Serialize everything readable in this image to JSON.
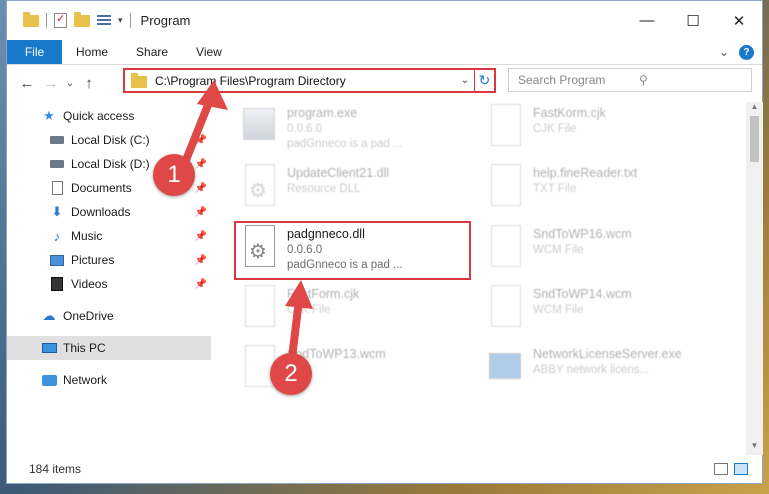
{
  "window": {
    "title": "Program",
    "controls": {
      "minimize": "—",
      "maximize": "☐",
      "close": "✕"
    }
  },
  "ribbon": {
    "tabs": [
      "File",
      "Home",
      "Share",
      "View"
    ],
    "expand": "⌄",
    "help": "?"
  },
  "nav": {
    "back": "←",
    "forward": "→",
    "recent": "⌄",
    "up": "↑",
    "address": "C:\\Program Files\\Program Directory",
    "address_dropdown": "⌄",
    "refresh": "↻",
    "search_placeholder": "Search Program",
    "search_icon": "⚲"
  },
  "sidebar": {
    "items": [
      {
        "label": "Quick access",
        "icon": "star-icon"
      },
      {
        "label": "Local Disk (C:)",
        "icon": "drive-icon",
        "pinned": true
      },
      {
        "label": "Local Disk (D:)",
        "icon": "drive-icon",
        "pinned": true
      },
      {
        "label": "Documents",
        "icon": "document-icon",
        "pinned": true
      },
      {
        "label": "Downloads",
        "icon": "download-icon",
        "pinned": true
      },
      {
        "label": "Music",
        "icon": "music-icon",
        "pinned": true
      },
      {
        "label": "Pictures",
        "icon": "picture-icon",
        "pinned": true
      },
      {
        "label": "Videos",
        "icon": "video-icon",
        "pinned": true
      },
      {
        "label": "OneDrive",
        "icon": "cloud-icon"
      },
      {
        "label": "This PC",
        "icon": "computer-icon",
        "selected": true
      },
      {
        "label": "Network",
        "icon": "network-icon"
      }
    ],
    "pin_glyph": "📌"
  },
  "files": [
    {
      "name": "program.exe",
      "line2": "0.0.6.0",
      "line3": "padGnneco is a pad ...",
      "icon": "exe-icon"
    },
    {
      "name": "UpdateClient21.dll",
      "line2": "Resource DLL",
      "line3": "",
      "icon": "dll-icon"
    },
    {
      "name": "padgnneco.dll",
      "line2": "0.0.6.0",
      "line3": "padGnneco is a pad ...",
      "icon": "dll-icon"
    },
    {
      "name": "FastForm.cjk",
      "line2": "CJK File",
      "line3": "",
      "icon": "file-icon"
    },
    {
      "name": "SndToWP13.wcm",
      "line2": "",
      "line3": "",
      "icon": "file-icon"
    },
    {
      "name": "FastKorm.cjk",
      "line2": "CJK File",
      "line3": "",
      "icon": "file-icon"
    },
    {
      "name": "help.fineReader.txt",
      "line2": "TXT File",
      "line3": "",
      "icon": "file-icon"
    },
    {
      "name": "SndToWP16.wcm",
      "line2": "WCM File",
      "line3": "",
      "icon": "file-icon"
    },
    {
      "name": "SndToWP14.wcm",
      "line2": "WCM File",
      "line3": "",
      "icon": "file-icon"
    },
    {
      "name": "NetworkLicenseServer.exe",
      "line2": "ABBY network licens...",
      "line3": "",
      "icon": "app-icon"
    }
  ],
  "annotations": {
    "step1": "1",
    "step2": "2",
    "color": "#d9383e"
  },
  "status": {
    "item_count": "184 items"
  },
  "colors": {
    "accent": "#1979ca",
    "highlight": "#d9383e"
  }
}
